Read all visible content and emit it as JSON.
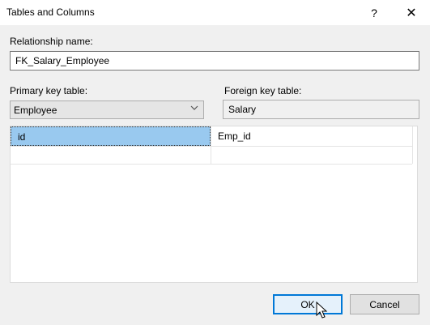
{
  "window": {
    "title": "Tables and Columns",
    "help_glyph": "?",
    "close_glyph": "✕"
  },
  "relationship": {
    "label": "Relationship name:",
    "value": "FK_Salary_Employee"
  },
  "primary": {
    "label": "Primary key table:",
    "value": "Employee"
  },
  "foreign": {
    "label": "Foreign key table:",
    "value": "Salary"
  },
  "columns": {
    "rows": [
      {
        "primary": "id",
        "foreign": "Emp_id"
      }
    ]
  },
  "buttons": {
    "ok": "OK",
    "cancel": "Cancel"
  },
  "colors": {
    "selection": "#99c9ef",
    "accent": "#0078d7"
  }
}
